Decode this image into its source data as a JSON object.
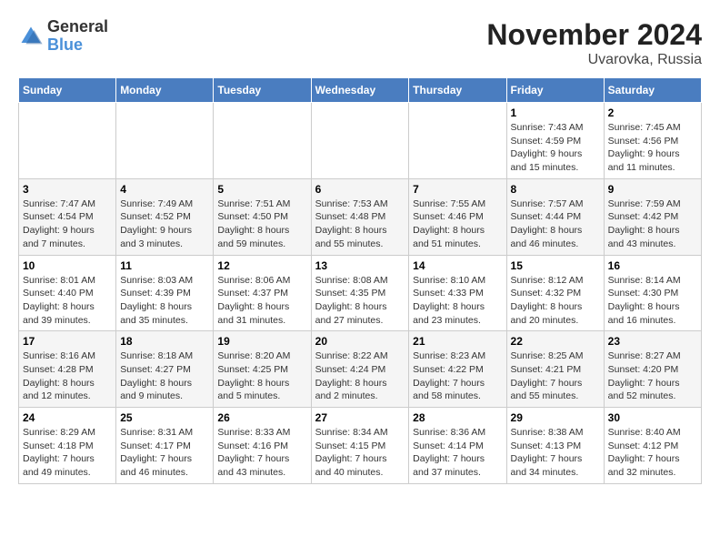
{
  "logo": {
    "general": "General",
    "blue": "Blue"
  },
  "title": "November 2024",
  "subtitle": "Uvarovka, Russia",
  "days_header": [
    "Sunday",
    "Monday",
    "Tuesday",
    "Wednesday",
    "Thursday",
    "Friday",
    "Saturday"
  ],
  "weeks": [
    [
      {
        "day": "",
        "info": ""
      },
      {
        "day": "",
        "info": ""
      },
      {
        "day": "",
        "info": ""
      },
      {
        "day": "",
        "info": ""
      },
      {
        "day": "",
        "info": ""
      },
      {
        "day": "1",
        "info": "Sunrise: 7:43 AM\nSunset: 4:59 PM\nDaylight: 9 hours and 15 minutes."
      },
      {
        "day": "2",
        "info": "Sunrise: 7:45 AM\nSunset: 4:56 PM\nDaylight: 9 hours and 11 minutes."
      }
    ],
    [
      {
        "day": "3",
        "info": "Sunrise: 7:47 AM\nSunset: 4:54 PM\nDaylight: 9 hours and 7 minutes."
      },
      {
        "day": "4",
        "info": "Sunrise: 7:49 AM\nSunset: 4:52 PM\nDaylight: 9 hours and 3 minutes."
      },
      {
        "day": "5",
        "info": "Sunrise: 7:51 AM\nSunset: 4:50 PM\nDaylight: 8 hours and 59 minutes."
      },
      {
        "day": "6",
        "info": "Sunrise: 7:53 AM\nSunset: 4:48 PM\nDaylight: 8 hours and 55 minutes."
      },
      {
        "day": "7",
        "info": "Sunrise: 7:55 AM\nSunset: 4:46 PM\nDaylight: 8 hours and 51 minutes."
      },
      {
        "day": "8",
        "info": "Sunrise: 7:57 AM\nSunset: 4:44 PM\nDaylight: 8 hours and 46 minutes."
      },
      {
        "day": "9",
        "info": "Sunrise: 7:59 AM\nSunset: 4:42 PM\nDaylight: 8 hours and 43 minutes."
      }
    ],
    [
      {
        "day": "10",
        "info": "Sunrise: 8:01 AM\nSunset: 4:40 PM\nDaylight: 8 hours and 39 minutes."
      },
      {
        "day": "11",
        "info": "Sunrise: 8:03 AM\nSunset: 4:39 PM\nDaylight: 8 hours and 35 minutes."
      },
      {
        "day": "12",
        "info": "Sunrise: 8:06 AM\nSunset: 4:37 PM\nDaylight: 8 hours and 31 minutes."
      },
      {
        "day": "13",
        "info": "Sunrise: 8:08 AM\nSunset: 4:35 PM\nDaylight: 8 hours and 27 minutes."
      },
      {
        "day": "14",
        "info": "Sunrise: 8:10 AM\nSunset: 4:33 PM\nDaylight: 8 hours and 23 minutes."
      },
      {
        "day": "15",
        "info": "Sunrise: 8:12 AM\nSunset: 4:32 PM\nDaylight: 8 hours and 20 minutes."
      },
      {
        "day": "16",
        "info": "Sunrise: 8:14 AM\nSunset: 4:30 PM\nDaylight: 8 hours and 16 minutes."
      }
    ],
    [
      {
        "day": "17",
        "info": "Sunrise: 8:16 AM\nSunset: 4:28 PM\nDaylight: 8 hours and 12 minutes."
      },
      {
        "day": "18",
        "info": "Sunrise: 8:18 AM\nSunset: 4:27 PM\nDaylight: 8 hours and 9 minutes."
      },
      {
        "day": "19",
        "info": "Sunrise: 8:20 AM\nSunset: 4:25 PM\nDaylight: 8 hours and 5 minutes."
      },
      {
        "day": "20",
        "info": "Sunrise: 8:22 AM\nSunset: 4:24 PM\nDaylight: 8 hours and 2 minutes."
      },
      {
        "day": "21",
        "info": "Sunrise: 8:23 AM\nSunset: 4:22 PM\nDaylight: 7 hours and 58 minutes."
      },
      {
        "day": "22",
        "info": "Sunrise: 8:25 AM\nSunset: 4:21 PM\nDaylight: 7 hours and 55 minutes."
      },
      {
        "day": "23",
        "info": "Sunrise: 8:27 AM\nSunset: 4:20 PM\nDaylight: 7 hours and 52 minutes."
      }
    ],
    [
      {
        "day": "24",
        "info": "Sunrise: 8:29 AM\nSunset: 4:18 PM\nDaylight: 7 hours and 49 minutes."
      },
      {
        "day": "25",
        "info": "Sunrise: 8:31 AM\nSunset: 4:17 PM\nDaylight: 7 hours and 46 minutes."
      },
      {
        "day": "26",
        "info": "Sunrise: 8:33 AM\nSunset: 4:16 PM\nDaylight: 7 hours and 43 minutes."
      },
      {
        "day": "27",
        "info": "Sunrise: 8:34 AM\nSunset: 4:15 PM\nDaylight: 7 hours and 40 minutes."
      },
      {
        "day": "28",
        "info": "Sunrise: 8:36 AM\nSunset: 4:14 PM\nDaylight: 7 hours and 37 minutes."
      },
      {
        "day": "29",
        "info": "Sunrise: 8:38 AM\nSunset: 4:13 PM\nDaylight: 7 hours and 34 minutes."
      },
      {
        "day": "30",
        "info": "Sunrise: 8:40 AM\nSunset: 4:12 PM\nDaylight: 7 hours and 32 minutes."
      }
    ]
  ]
}
